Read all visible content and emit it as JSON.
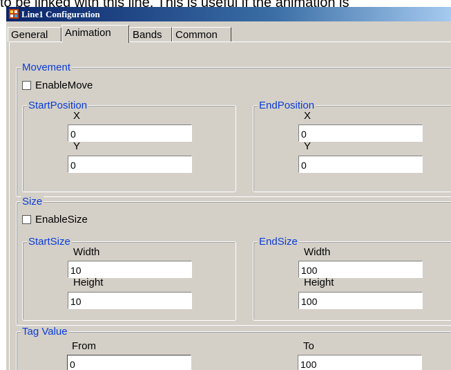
{
  "document": {
    "line": "to be linked with this line. This is useful if the animation is"
  },
  "window": {
    "title": "Line1 Configuration",
    "icon": "app-icon"
  },
  "tabs": [
    "General",
    "Animation",
    "Bands",
    "Common"
  ],
  "active_tab": "Animation",
  "movement": {
    "title": "Movement",
    "enable_label": "EnableMove",
    "start": {
      "title": "StartPosition",
      "x_label": "X",
      "x_value": "0",
      "y_label": "Y",
      "y_value": "0"
    },
    "end": {
      "title": "EndPosition",
      "x_label": "X",
      "x_value": "0",
      "y_label": "Y",
      "y_value": "0"
    }
  },
  "size": {
    "title": "Size",
    "enable_label": "EnableSize",
    "start": {
      "title": "StartSize",
      "w_label": "Width",
      "w_value": "10",
      "h_label": "Height",
      "h_value": "10"
    },
    "end": {
      "title": "EndSize",
      "w_label": "Width",
      "w_value": "100",
      "h_label": "Height",
      "h_value": "100"
    }
  },
  "tag_value": {
    "title": "Tag Value",
    "from_label": "From",
    "from_value": "0",
    "to_label": "To",
    "to_value": "100"
  }
}
